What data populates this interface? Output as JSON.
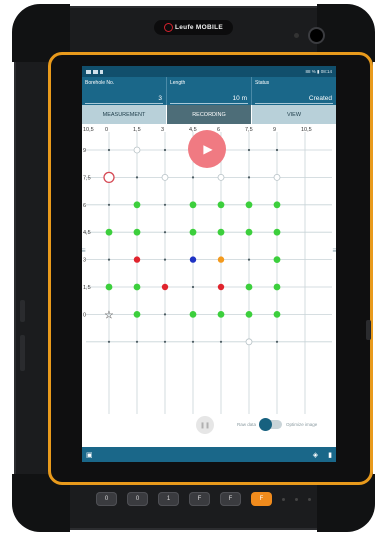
{
  "device": {
    "brand": "Leufe MOBILE",
    "hw_buttons": [
      "0",
      "0",
      "1",
      "F",
      "F",
      "F"
    ]
  },
  "statusbar": {
    "right": "88 % ▮ 08:14"
  },
  "header": {
    "fields": [
      {
        "label": "Borehole No.",
        "value": "3"
      },
      {
        "label": "Length",
        "value": "10 m"
      },
      {
        "label": "Status",
        "value": "Created"
      }
    ]
  },
  "tabs": [
    {
      "label": "MEASUREMENT",
      "active": false
    },
    {
      "label": "RECORDING",
      "active": true
    },
    {
      "label": "VIEW",
      "active": false
    }
  ],
  "grid": {
    "x_ticks": [
      "10,5",
      "0",
      "1,5",
      "3",
      "4,5",
      "6",
      "7,5",
      "9",
      "10,5"
    ],
    "y_ticks": [
      "0",
      "1,5",
      "3",
      "4,5",
      "6",
      "7,5",
      "9",
      "10,5"
    ],
    "colors": {
      "green": "#3ccf3c",
      "red": "#e0242d",
      "blue": "#1f33c4",
      "orange": "#f39a1e",
      "empty": "#b7c2c6",
      "ring": "#d64a55"
    },
    "rows": [
      {
        "y": "9",
        "points": [
          "x",
          "o",
          "x",
          "x",
          "o",
          "x",
          "x"
        ]
      },
      {
        "y": "7,5",
        "points": [
          "r",
          "x",
          "o",
          "x",
          "o",
          "x",
          "o"
        ]
      },
      {
        "y": "6",
        "points": [
          "x",
          "g",
          "x",
          "g",
          "g",
          "g",
          "g"
        ]
      },
      {
        "y": "4,5",
        "points": [
          "g",
          "g",
          "x",
          "g",
          "g",
          "g",
          "g"
        ]
      },
      {
        "y": "3",
        "points": [
          "x",
          "R",
          "x",
          "B",
          "O",
          "x",
          "g"
        ]
      },
      {
        "y": "1,5",
        "points": [
          "g",
          "g",
          "R",
          "x",
          "R",
          "g",
          "g"
        ]
      },
      {
        "y": "0",
        "points": [
          "s",
          "g",
          "x",
          "g",
          "g",
          "g",
          "g"
        ]
      },
      {
        "y": "",
        "points": [
          "x",
          "x",
          "x",
          "x",
          "x",
          "o",
          "x"
        ]
      }
    ]
  },
  "controls": {
    "play_icon": "play-icon",
    "pause_icon": "pause-icon",
    "toggle_left": "Raw data",
    "toggle_right": "Optimize image"
  }
}
